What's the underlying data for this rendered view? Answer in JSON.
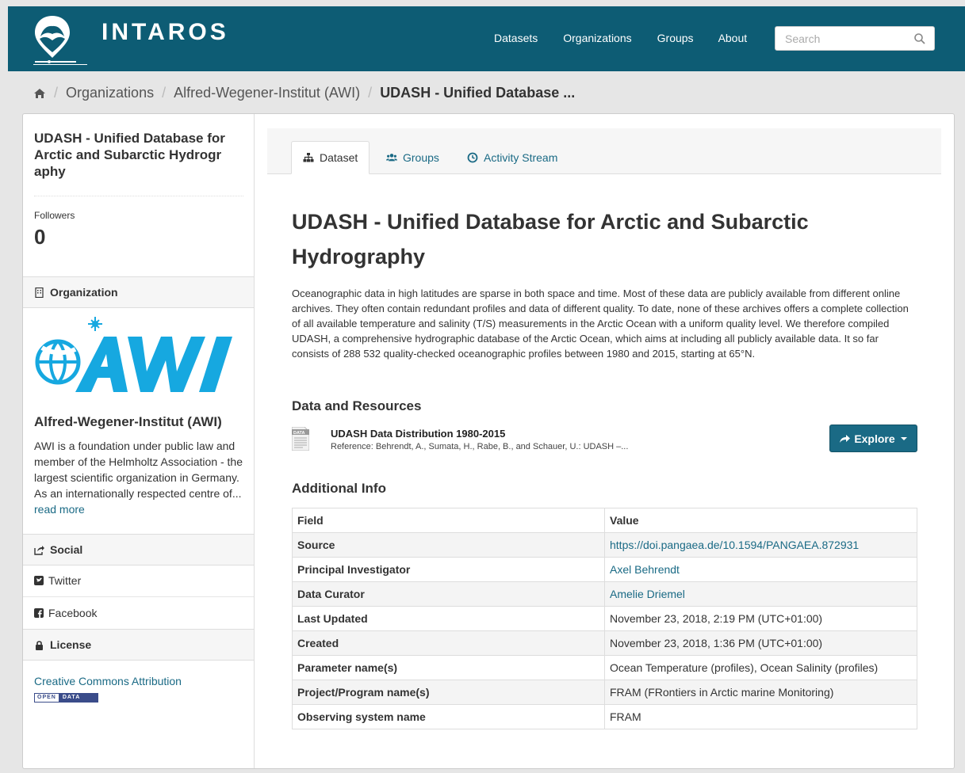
{
  "header": {
    "brand": "INTAROS",
    "nav": [
      "Datasets",
      "Organizations",
      "Groups",
      "About"
    ],
    "search_placeholder": "Search"
  },
  "breadcrumb": {
    "items": [
      "Organizations",
      "Alfred-Wegener-Institut (AWI)"
    ],
    "active": "UDASH - Unified Database ..."
  },
  "sidebar": {
    "title": "UDASH - Unified Database for Arctic and Subarctic Hydrogr aphy",
    "followers_label": "Followers",
    "followers_count": "0",
    "organization_heading": "Organization",
    "org_name": "Alfred-Wegener-Institut (AWI)",
    "org_description": "AWI is a foundation under public law and member of the Helmholtz Association - the largest scientific organization in Germany. As an internationally respected centre of...",
    "read_more": "read more",
    "social_heading": "Social",
    "twitter": "Twitter",
    "facebook": "Facebook",
    "license_heading": "License",
    "license_link": "Creative Commons Attribution",
    "open_data_left": "OPEN",
    "open_data_right": "DATA"
  },
  "tabs": [
    {
      "label": "Dataset",
      "icon": "sitemap-icon",
      "active": true
    },
    {
      "label": "Groups",
      "icon": "users-icon",
      "active": false
    },
    {
      "label": "Activity Stream",
      "icon": "clock-icon",
      "active": false
    }
  ],
  "dataset": {
    "title": "UDASH - Unified Database for Arctic and Subarctic Hydrography",
    "notes": "Oceanographic data in high latitudes are sparse in both space and time. Most of these data are publicly available from different online archives. They often contain redundant profiles and data of different quality. To date, none of these archives offers a complete collection of all available temperature and salinity (T/S) measurements in the Arctic Ocean with a uniform quality level. We therefore compiled UDASH, a comprehensive hydrographic database of the Arctic Ocean, which aims at including all publicly available data. It so far consists of 288 532 quality-checked oceanographic profiles between 1980 and 2015, starting at 65°N."
  },
  "resources": {
    "heading": "Data and Resources",
    "items": [
      {
        "title": "UDASH Data Distribution 1980-2015",
        "description": "Reference: Behrendt, A., Sumata, H., Rabe, B., and Schauer, U.: UDASH –...",
        "format_label": "DATA",
        "explore_label": "Explore"
      }
    ]
  },
  "additional_info": {
    "heading": "Additional Info",
    "columns": [
      "Field",
      "Value"
    ],
    "rows": [
      {
        "field": "Source",
        "value": "https://doi.pangaea.de/10.1594/PANGAEA.872931",
        "link": true
      },
      {
        "field": "Principal Investigator",
        "value": "Axel Behrendt",
        "link": true
      },
      {
        "field": "Data Curator",
        "value": "Amelie Driemel",
        "link": true
      },
      {
        "field": "Last Updated",
        "value": "November 23, 2018, 2:19 PM (UTC+01:00)",
        "link": false
      },
      {
        "field": "Created",
        "value": "November 23, 2018, 1:36 PM (UTC+01:00)",
        "link": false
      },
      {
        "field": "Parameter name(s)",
        "value": "Ocean Temperature (profiles), Ocean Salinity (profiles)",
        "link": false
      },
      {
        "field": "Project/Program name(s)",
        "value": "FRAM (FRontiers in Arctic marine Monitoring)",
        "link": false
      },
      {
        "field": "Observing system name",
        "value": "FRAM",
        "link": false
      }
    ]
  },
  "colors": {
    "masthead": "#0d5c74",
    "link": "#1a6a85",
    "awi_blue": "#16a8e0"
  }
}
